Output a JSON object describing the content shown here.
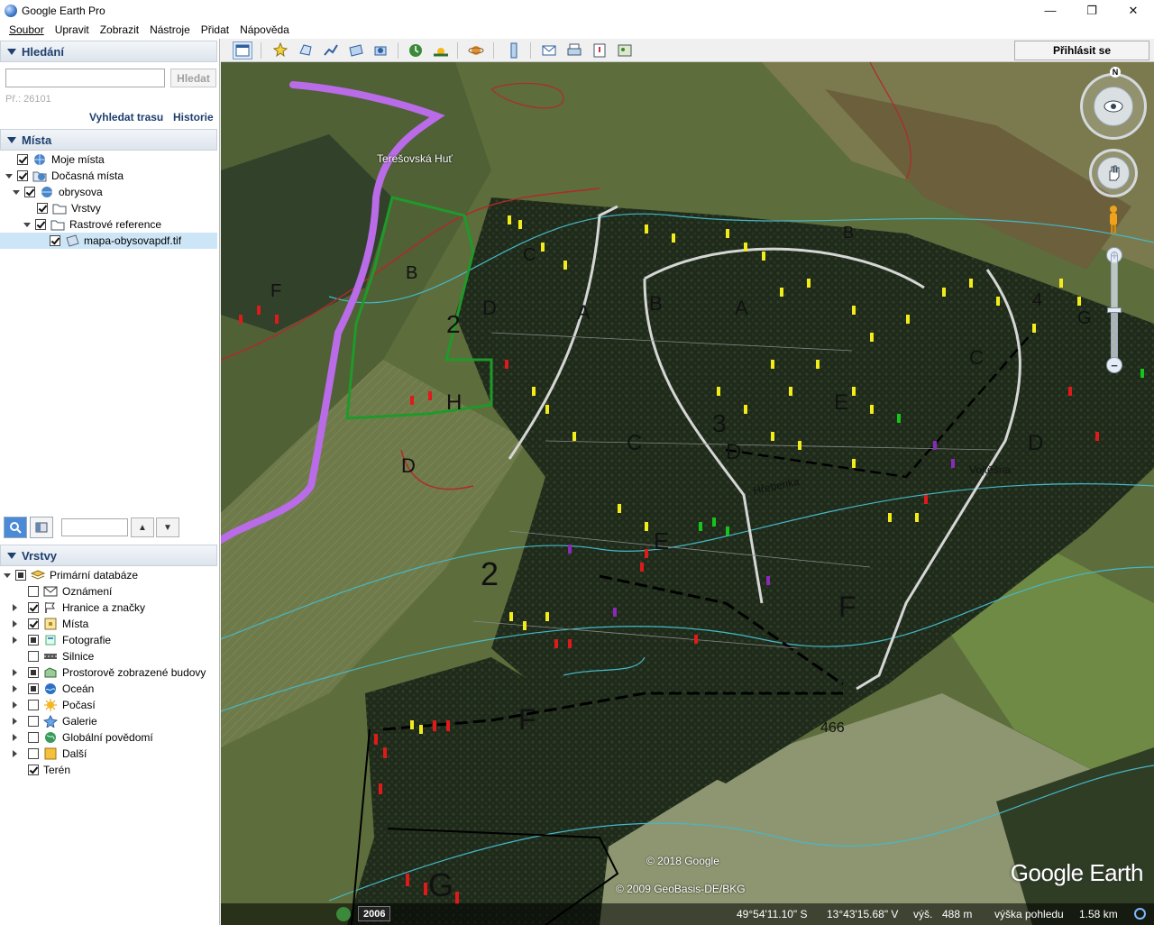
{
  "window": {
    "title": "Google Earth Pro",
    "minimize": "—",
    "maximize": "❐",
    "close": "✕"
  },
  "menu": [
    "Soubor",
    "Upravit",
    "Zobrazit",
    "Nástroje",
    "Přidat",
    "Nápověda"
  ],
  "search": {
    "heading": "Hledání",
    "input_value": "",
    "button": "Hledat",
    "hint": "Př.: 26101",
    "route_link": "Vyhledat trasu",
    "history_link": "Historie"
  },
  "places": {
    "heading": "Místa",
    "items": [
      {
        "label": "Moje místa",
        "checked": true
      },
      {
        "label": "Dočasná místa",
        "checked": true
      },
      {
        "label": "obrysova",
        "checked": true
      },
      {
        "label": "Vrstvy",
        "checked": true
      },
      {
        "label": "Rastrové reference",
        "checked": true
      },
      {
        "label": "mapa-obysovapdf.tif",
        "checked": true
      }
    ]
  },
  "layers": {
    "heading": "Vrstvy",
    "items": [
      {
        "label": "Primární databáze"
      },
      {
        "label": "Oznámení"
      },
      {
        "label": "Hranice a značky"
      },
      {
        "label": "Místa"
      },
      {
        "label": "Fotografie"
      },
      {
        "label": "Silnice"
      },
      {
        "label": "Prostorově zobrazené budovy"
      },
      {
        "label": "Oceán"
      },
      {
        "label": "Počasí"
      },
      {
        "label": "Galerie"
      },
      {
        "label": "Globální povědomí"
      },
      {
        "label": "Další"
      },
      {
        "label": "Terén"
      }
    ]
  },
  "toolbar": {
    "signin": "Přihlásit se"
  },
  "map": {
    "place_label": "Terešovská Huť",
    "copyright_1": "© 2018 Google",
    "copyright_2": "© 2009 GeoBasis-DE/BKG",
    "brand": "Google Earth",
    "north": "N",
    "map_letters": [
      "A",
      "B",
      "C",
      "D",
      "E",
      "F",
      "G",
      "H",
      "2",
      "3"
    ],
    "labels": {
      "vojtechna": "Vojtěšna",
      "hrebenka": "Hřebenka",
      "elev": "466"
    }
  },
  "status": {
    "year": "2006",
    "lat": "49°54'11.10\" S",
    "lon": "13°43'15.68\" V",
    "alt_label": "výš.",
    "alt_value": "488 m",
    "eye_label": "výška pohledu",
    "eye_value": "1.58 km"
  }
}
